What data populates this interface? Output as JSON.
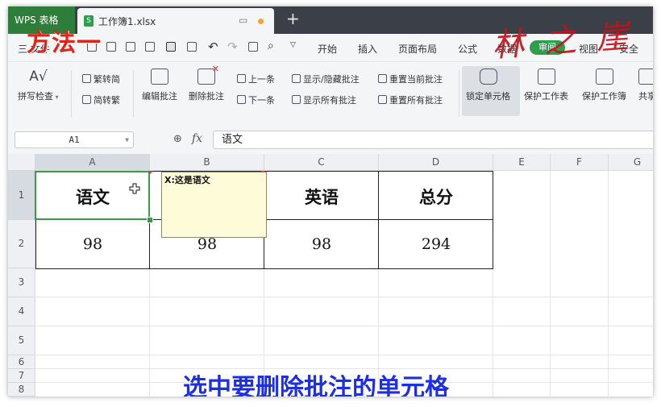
{
  "app": {
    "name": "WPS 表格"
  },
  "document_tab": {
    "title": "工作簿1.xlsx",
    "icon": "spreadsheet-icon"
  },
  "new_tab_label": "+",
  "menu": {
    "file_label": "三 文件",
    "items": [
      "开始",
      "插入",
      "页面布局",
      "公式",
      "数据",
      "审阅",
      "视图",
      "安全"
    ],
    "active": "审阅"
  },
  "ribbon": {
    "spellcheck": "拼写检查",
    "trad_to_simp": "繁转简",
    "simp_to_trad": "简转繁",
    "edit_comment": "编辑批注",
    "delete_comment": "删除批注",
    "prev_comment": "上一条",
    "next_comment": "下一条",
    "show_hide_comment": "显示/隐藏批注",
    "show_all_comments": "显示所有批注",
    "reset_current_comment": "重置当前批注",
    "reset_all_comments": "重置所有批注",
    "lock_cell": "锁定单元格",
    "protect_sheet": "保护工作表",
    "protect_workbook": "保护工作簿",
    "share": "共享"
  },
  "formula_bar": {
    "cell_ref": "A1",
    "fx_label": "fx",
    "content": "语文"
  },
  "sheet": {
    "columns": [
      "A",
      "B",
      "C",
      "D",
      "E",
      "F",
      "G"
    ],
    "rows": [
      "1",
      "2",
      "3",
      "4",
      "5",
      "6",
      "7",
      "8"
    ],
    "headers": {
      "A1": "语文",
      "C1": "英语",
      "D1": "总分"
    },
    "values": {
      "A2": "98",
      "B2": "98",
      "C2": "98",
      "D2": "294"
    },
    "comment": {
      "author": "X:这是语文"
    }
  },
  "overlay": {
    "method_title": "方法一",
    "brand": "林 之 崖",
    "caption": "选中要删除批注的单元格"
  },
  "colors": {
    "accent": "#2e9e4c",
    "caption": "#1d2fe0",
    "title_red": "#e22418"
  }
}
